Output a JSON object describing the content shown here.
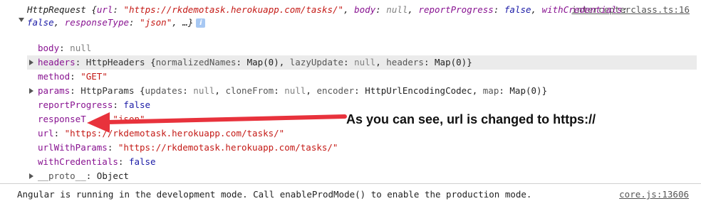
{
  "console": {
    "source_link": "intercepterclass.ts:16",
    "summary": {
      "line1_name": "HttpRequest",
      "line1_open": " {",
      "url_key": "url",
      "url_val": "\"https://rkdemotask.herokuapp.com/tasks/\"",
      "body_key": "body",
      "body_val": "null",
      "reportProgress_key": "reportProgress",
      "reportProgress_val": "false",
      "withCredentials_key": "withCredentials",
      "line2_val": "false",
      "responseType_key": "responseType",
      "responseType_val": "\"json\"",
      "ellipsis": "…}",
      "info_icon": "i"
    },
    "props": {
      "body": {
        "key": "body",
        "val": "null"
      },
      "headers": {
        "key": "headers",
        "cls": "HttpHeaders",
        "detail_open": " {",
        "k1": "normalizedNames",
        "v1": "Map(0)",
        "k2": "lazyUpdate",
        "v2": "null",
        "k3": "headers",
        "v3": "Map(0)",
        "close": "}"
      },
      "method": {
        "key": "method",
        "val": "\"GET\""
      },
      "params": {
        "key": "params",
        "cls": "HttpParams",
        "detail_open": " {",
        "k1": "updates",
        "v1": "null",
        "k2": "cloneFrom",
        "v2": "null",
        "k3": "encoder",
        "v3": "HttpUrlEncodingCodec",
        "k4": "map",
        "v4": "Map(0)",
        "close": "}"
      },
      "reportProgress": {
        "key": "reportProgress",
        "val": "false"
      },
      "responseType": {
        "key": "responseT",
        "val": "\"json\""
      },
      "url": {
        "key": "url",
        "val": "\"https://rkdemotask.herokuapp.com/tasks/\""
      },
      "urlWithParams": {
        "key": "urlWithParams",
        "val": "\"https://rkdemotask.herokuapp.com/tasks/\""
      },
      "withCredentials": {
        "key": "withCredentials",
        "val": "false"
      },
      "proto": {
        "key": "__proto__",
        "val": "Object"
      }
    }
  },
  "annotation": {
    "text": "As you can see, url is changed to https://",
    "arrow_color": "#e8323c"
  },
  "footer": {
    "message": "Angular is running in the development mode. Call enableProdMode() to enable the production mode.",
    "source_link": "core.js:13606"
  }
}
